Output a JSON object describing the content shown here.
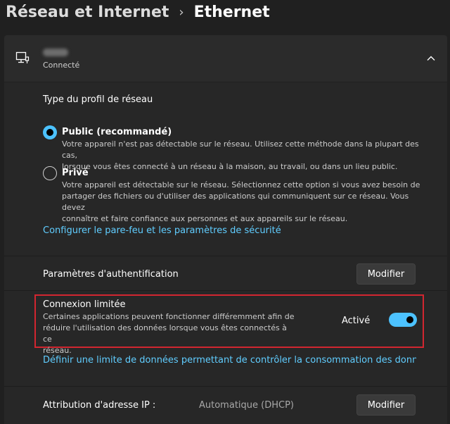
{
  "breadcrumb": {
    "parent": "Réseau et Internet",
    "separator": "›",
    "current": "Ethernet"
  },
  "connection": {
    "status": "Connecté",
    "icon": "network-monitor-icon",
    "expand_icon": "chevron-up-icon"
  },
  "profile": {
    "title": "Type du profil de réseau",
    "options": [
      {
        "label": "Public (recommandé)",
        "description_lines": [
          "Votre appareil n'est pas détectable sur le réseau. Utilisez cette méthode dans la plupart des cas,",
          "lorsque vous êtes connecté à un réseau à la maison, au travail, ou dans un lieu public."
        ],
        "selected": true
      },
      {
        "label": "Privé",
        "description_lines": [
          "Votre appareil est détectable sur le réseau. Sélectionnez cette option si vous avez besoin de",
          "partager des fichiers ou d'utiliser des applications qui communiquent sur ce réseau. Vous devez",
          "connaître et faire confiance aux personnes et aux appareils sur le réseau."
        ],
        "selected": false
      }
    ],
    "firewall_link": "Configurer le pare-feu et les paramètres de sécurité"
  },
  "auth": {
    "label": "Paramètres d'authentification",
    "button": "Modifier"
  },
  "metered": {
    "title": "Connexion limitée",
    "description_lines": [
      "Certaines applications peuvent fonctionner différemment afin de",
      "réduire l'utilisation des données lorsque vous êtes connectés à ce",
      "réseau."
    ],
    "state_label": "Activé",
    "enabled": true,
    "data_limit_link": "Définir une limite de données permettant de contrôler la consommation des données sur ce réseau"
  },
  "ip": {
    "label": "Attribution d'adresse IP :",
    "value": "Automatique (DHCP)",
    "button": "Modifier"
  },
  "colors": {
    "accent": "#4cc2ff",
    "link": "#60cdff",
    "highlight_border": "#d22630",
    "background": "#202020"
  }
}
